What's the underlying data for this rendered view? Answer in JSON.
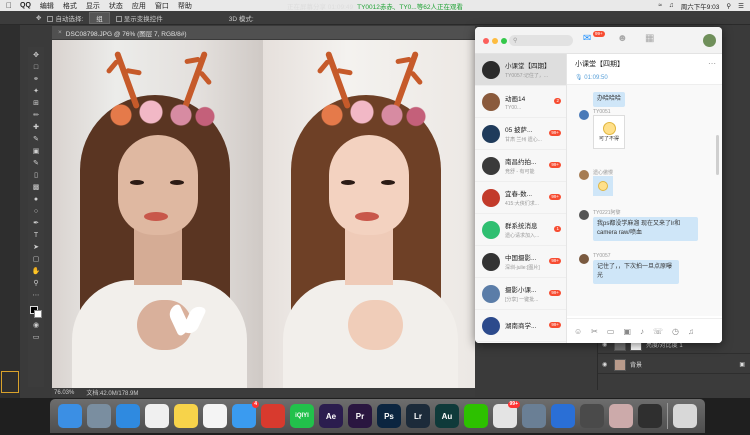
{
  "menubar": {
    "app": "QQ",
    "items": [
      "编辑",
      "格式",
      "显示",
      "状态",
      "应用",
      "窗口",
      "帮助"
    ],
    "share_status": "正在屏幕分享 01:09:49",
    "share_viewers": "TY0012赤赤、TY0...等62人正在观看",
    "clock": "周六下午9:03"
  },
  "ps": {
    "options": {
      "auto_select_label": "自动选择:",
      "layer_select": "组",
      "show_transform": "显示变换控件",
      "mode_3d": "3D 模式:"
    },
    "doc_tab": "DSC08798.JPG @ 76% (图层 7, RGB/8#)",
    "status_zoom": "76.03%",
    "status_doc": "文档:42.0M/178.9M",
    "layers": [
      {
        "name": "亮度/对比度 1"
      },
      {
        "name": "背景"
      }
    ]
  },
  "qq": {
    "search_placeholder": "搜索",
    "top_badge": "99+",
    "conversations": [
      {
        "name": "小课堂【四期】",
        "preview": "TY0057:记住了，...",
        "badge": "",
        "color": "#2b2b2b"
      },
      {
        "name": "动画14",
        "preview": "TY00...",
        "badge": "2",
        "color": "#8a5a3c"
      },
      {
        "name": "05 披萨...",
        "preview": "甘肃 兰州 遗心...",
        "badge": "99+",
        "color": "#1f3b5b"
      },
      {
        "name": "南昌约拍...",
        "preview": "竞舒 - 有可能",
        "badge": "99+",
        "color": "#3a3a3a"
      },
      {
        "name": "宜春-数...",
        "preview": "415:大侠们求...",
        "badge": "99+",
        "color": "#c23a2a"
      },
      {
        "name": "群系统消息",
        "preview": "遗心请求加入...",
        "badge": "1",
        "color": "#2fbf71"
      },
      {
        "name": "中国摄影...",
        "preview": "深圳-julie:[图片]",
        "badge": "99+",
        "color": "#333333"
      },
      {
        "name": "摄影小课...",
        "preview": "[分享] 一键批...",
        "badge": "99+",
        "color": "#5b7da8"
      },
      {
        "name": "湖南商学...",
        "preview": "",
        "badge": "99+",
        "color": "#2c4a8c"
      }
    ],
    "chat": {
      "title": "小课堂【四期】",
      "audio_duration": "01:09:50",
      "messages": [
        {
          "sender": "",
          "text": "办哈哈哈",
          "type": "text"
        },
        {
          "sender": "TY0051",
          "text": "可了不得",
          "type": "sticker"
        },
        {
          "sender": "遗心傲慢",
          "text": "",
          "type": "sticker"
        },
        {
          "sender": "TY0221阿黎",
          "text": "我ps都没学麻溜  现在又来了lr和camera raw/喷血",
          "type": "text"
        },
        {
          "sender": "TY0057",
          "text": "记住了，，下次拍一旦点原曝光",
          "type": "text"
        }
      ],
      "tools": [
        "smiley-icon",
        "scissors-icon",
        "folder-icon",
        "image-icon",
        "mic-icon",
        "phone-icon",
        "clock-icon",
        "bell-icon"
      ]
    }
  },
  "dock": {
    "apps": [
      {
        "name": "Finder",
        "label": "",
        "color": "#3b8fe4"
      },
      {
        "name": "Preview",
        "label": "",
        "color": "#7a8ea0"
      },
      {
        "name": "Safari",
        "label": "",
        "color": "#2f8ae0"
      },
      {
        "name": "Reminders",
        "label": "",
        "color": "#f0f0f0"
      },
      {
        "name": "Notes",
        "label": "",
        "color": "#f7d34a"
      },
      {
        "name": "Photos",
        "label": "",
        "color": "#f4f4f4"
      },
      {
        "name": "App Store",
        "label": "",
        "color": "#3a9bf0",
        "badge": "4"
      },
      {
        "name": "NetEase Music",
        "label": "",
        "color": "#d83a2e"
      },
      {
        "name": "iQIYI",
        "label": "iQIYI",
        "color": "#22c14b"
      },
      {
        "name": "After Effects",
        "label": "Ae",
        "color": "#2b1d4e"
      },
      {
        "name": "Premiere",
        "label": "Pr",
        "color": "#2a1640"
      },
      {
        "name": "Photoshop",
        "label": "Ps",
        "color": "#0b2540"
      },
      {
        "name": "Lightroom",
        "label": "Lr",
        "color": "#1c2b3a"
      },
      {
        "name": "Audition",
        "label": "Au",
        "color": "#0f3a3a"
      },
      {
        "name": "WeChat",
        "label": "",
        "color": "#2dc100"
      },
      {
        "name": "QQ",
        "label": "",
        "color": "#e4e4e4",
        "badge": "99+"
      },
      {
        "name": "Network",
        "label": "",
        "color": "#6a7f95"
      },
      {
        "name": "QuickTime",
        "label": "",
        "color": "#2a6fd6"
      },
      {
        "name": "Screen Recorder",
        "label": "",
        "color": "#4a4a4a"
      },
      {
        "name": "Photo",
        "label": "",
        "color": "#caa"
      },
      {
        "name": "Display",
        "label": "",
        "color": "#2f2f2f"
      },
      {
        "name": "Trash",
        "label": "",
        "color": "#d8d8d8"
      }
    ]
  }
}
